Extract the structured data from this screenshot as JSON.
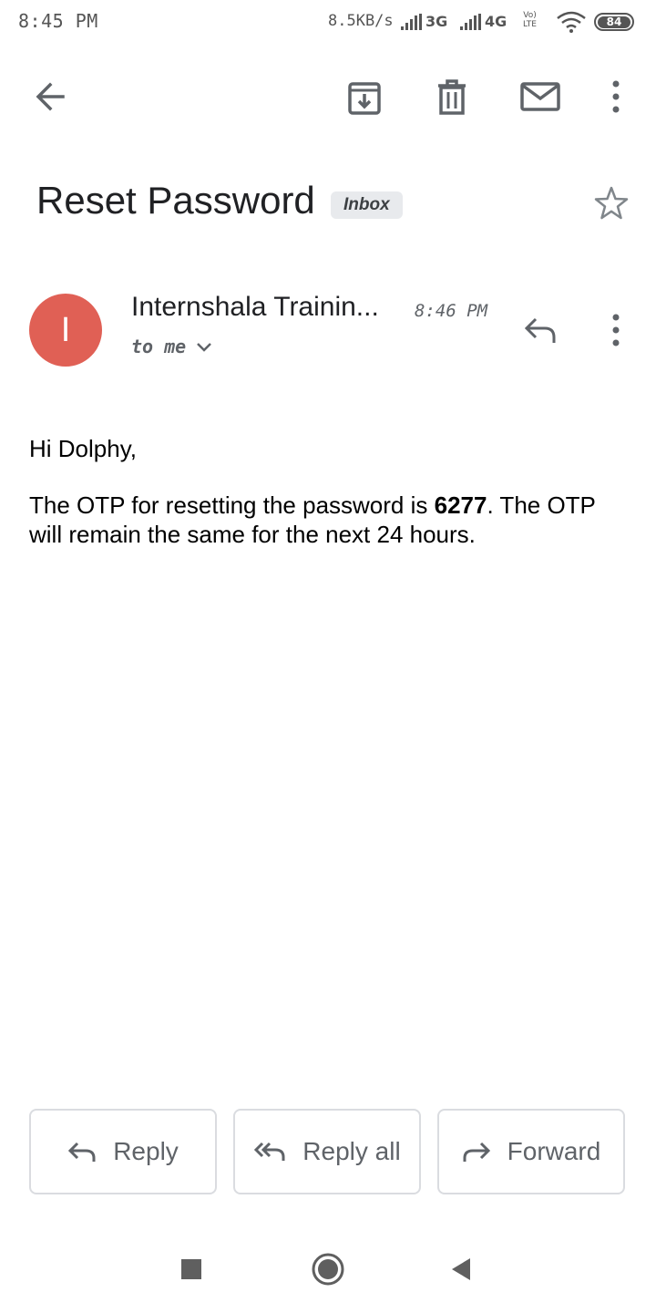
{
  "status_bar": {
    "time": "8:45 PM",
    "speed": "8.5KB/s",
    "network1": "3G",
    "network2": "4G",
    "volte_top": "Vo)",
    "volte_bottom": "LTE",
    "battery": "84"
  },
  "toolbar": {
    "back_icon": "arrow-left-icon",
    "archive_icon": "archive-icon",
    "delete_icon": "trash-icon",
    "mark_unread_icon": "mail-icon",
    "more_icon": "more-vertical-icon"
  },
  "email": {
    "subject": "Reset Password",
    "label": "Inbox",
    "star_icon": "star-outline-icon",
    "sender_initial": "I",
    "avatar_color": "#e06055",
    "sender": "Internshala Trainin...",
    "time": "8:46 PM",
    "recipient": "to me",
    "body": {
      "greeting": "Hi Dolphy,",
      "line_prefix": "The OTP for resetting the password is ",
      "otp": "6277",
      "line_suffix": ". The OTP will remain the same for the next 24 hours."
    }
  },
  "actions": {
    "reply": "Reply",
    "reply_all": "Reply all",
    "forward": "Forward"
  },
  "nav": {
    "recents_icon": "square-icon",
    "home_icon": "circle-icon",
    "back_icon": "triangle-back-icon"
  }
}
